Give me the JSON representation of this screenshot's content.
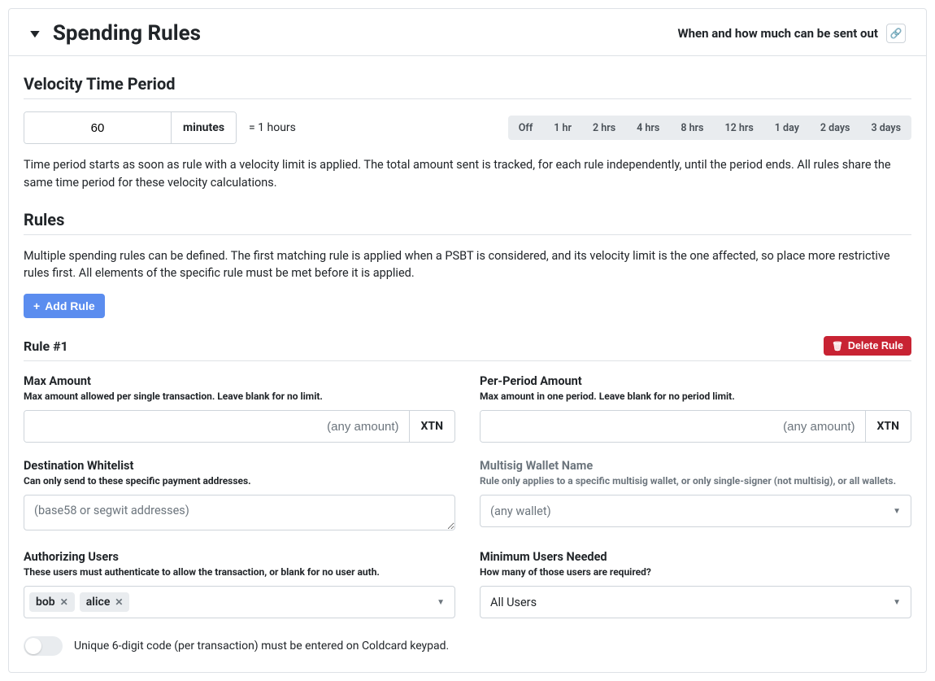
{
  "header": {
    "title": "Spending Rules",
    "subtitle": "When and how much can be sent out"
  },
  "velocity": {
    "heading": "Velocity Time Period",
    "value": "60",
    "unit": "minutes",
    "equals": "= 1 hours",
    "presets": [
      "Off",
      "1 hr",
      "2 hrs",
      "4 hrs",
      "8 hrs",
      "12 hrs",
      "1 day",
      "2 days",
      "3 days"
    ],
    "description": "Time period starts as soon as rule with a velocity limit is applied. The total amount sent is tracked, for each rule independently, until the period ends. All rules share the same time period for these velocity calculations."
  },
  "rules": {
    "heading": "Rules",
    "description": "Multiple spending rules can be defined. The first matching rule is applied when a PSBT is considered, and its velocity limit is the one affected, so place more restrictive rules first. All elements of the specific rule must be met before it is applied.",
    "add_label": "Add Rule"
  },
  "rule1": {
    "title": "Rule #1",
    "delete_label": "Delete Rule",
    "max_amount": {
      "label": "Max Amount",
      "sub": "Max amount allowed per single transaction. Leave blank for no limit.",
      "placeholder": "(any amount)",
      "unit": "XTN"
    },
    "per_period": {
      "label": "Per-Period Amount",
      "sub": "Max amount in one period. Leave blank for no period limit.",
      "placeholder": "(any amount)",
      "unit": "XTN"
    },
    "whitelist": {
      "label": "Destination Whitelist",
      "sub": "Can only send to these specific payment addresses.",
      "placeholder": "(base58 or segwit addresses)"
    },
    "multisig": {
      "label": "Multisig Wallet Name",
      "sub": "Rule only applies to a specific multisig wallet, or only single-signer (not multisig), or all wallets.",
      "value": "(any wallet)"
    },
    "auth_users": {
      "label": "Authorizing Users",
      "sub": "These users must authenticate to allow the transaction, or blank for no user auth.",
      "tags": [
        "bob",
        "alice"
      ]
    },
    "min_users": {
      "label": "Minimum Users Needed",
      "sub": "How many of those users are required?",
      "value": "All Users"
    },
    "toggle_label": "Unique 6-digit code (per transaction) must be entered on Coldcard keypad."
  }
}
